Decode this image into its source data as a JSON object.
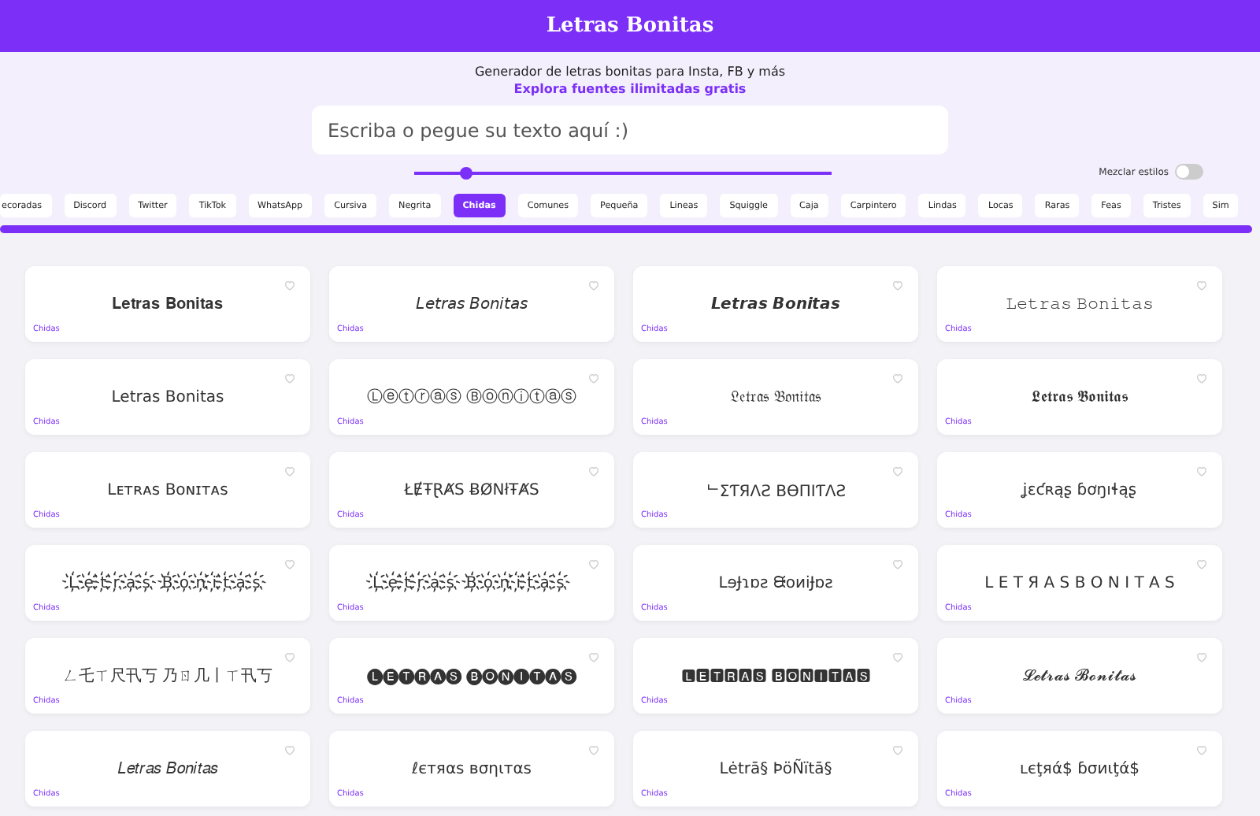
{
  "header": {
    "title": "Letras Bonitas"
  },
  "subtitle": "Generador de letras bonitas para Insta, FB y más",
  "link": "Explora fuentes ilimitadas gratis",
  "input": {
    "placeholder": "Escriba o pegue su texto aquí :)"
  },
  "size_slider": {
    "level": 0.13
  },
  "mix_toggle": {
    "label": "Mezclar estilos",
    "on": false
  },
  "tabs": [
    {
      "label": "ecoradas",
      "selected": false
    },
    {
      "label": "Discord",
      "selected": false
    },
    {
      "label": "Twitter",
      "selected": false
    },
    {
      "label": "TikTok",
      "selected": false
    },
    {
      "label": "WhatsApp",
      "selected": false
    },
    {
      "label": "Cursiva",
      "selected": false
    },
    {
      "label": "Negrita",
      "selected": false
    },
    {
      "label": "Chidas",
      "selected": true
    },
    {
      "label": "Comunes",
      "selected": false
    },
    {
      "label": "Pequeña",
      "selected": false
    },
    {
      "label": "Lineas",
      "selected": false
    },
    {
      "label": "Squiggle",
      "selected": false
    },
    {
      "label": "Caja",
      "selected": false
    },
    {
      "label": "Carpintero",
      "selected": false
    },
    {
      "label": "Lindas",
      "selected": false
    },
    {
      "label": "Locas",
      "selected": false
    },
    {
      "label": "Raras",
      "selected": false
    },
    {
      "label": "Feas",
      "selected": false
    },
    {
      "label": "Tristes",
      "selected": false
    },
    {
      "label": "Sim",
      "selected": false
    }
  ],
  "cards": [
    {
      "text": "𝐋𝐞𝐭𝐫𝐚𝐬 𝐁𝐨𝐧𝐢𝐭𝐚𝐬",
      "category": "Chidas"
    },
    {
      "text": "𝘓𝘦𝘵𝘳𝘢𝘴 𝘉𝘰𝘯𝘪𝘵𝘢𝘴",
      "category": "Chidas"
    },
    {
      "text": "𝙇𝙚𝙩𝙧𝙖𝙨 𝘽𝙤𝙣𝙞𝙩𝙖𝙨",
      "category": "Chidas"
    },
    {
      "text": "𝙻𝚎𝚝𝚛𝚊𝚜 𝙱𝚘𝚗𝚒𝚝𝚊𝚜",
      "category": "Chidas"
    },
    {
      "text": "Letras Bonitas",
      "category": "Chidas"
    },
    {
      "text": "Ⓛⓔⓣⓡⓐⓢ Ⓑⓞⓝⓘⓣⓐⓢ",
      "category": "Chidas"
    },
    {
      "text": "𝔏𝔢𝔱𝔯𝔞𝔰 𝔅𝔬𝔫𝔦𝔱𝔞𝔰",
      "category": "Chidas"
    },
    {
      "text": "𝕷𝖊𝖙𝖗𝖆𝖘 𝕭𝖔𝖓𝖎𝖙𝖆𝖘",
      "category": "Chidas"
    },
    {
      "text": "Lᴇᴛʀᴀs Bᴏɴɪᴛᴀs",
      "category": "Chidas"
    },
    {
      "text": "ŁɆŦⱤȺS ɃØNłŦȺS",
      "category": "Chidas"
    },
    {
      "text": "ᄂΣƬЯΛƧ ΒӨПIƬΛƧ",
      "category": "Chidas"
    },
    {
      "text": "ʝɛƈʀąʂ ɓơŋıɬąʂ",
      "category": "Chidas"
    },
    {
      "text": "L҉e҉t҉r҉a҉s҉ B҉o҉n҉i҉t҉a҉s҉",
      "category": "Chidas"
    },
    {
      "text": "L҉e҉t҉r҉a҉s҉ B҉o҉n҉i҉t҉a҉s҉",
      "category": "Chidas"
    },
    {
      "text": "LɘɈɿɒƨ ᙠoᴎiɈɒƨ",
      "category": "Chidas"
    },
    {
      "text": "L E T Я A S  B O N I T A S",
      "category": "Chidas"
    },
    {
      "text": "ㄥ乇ㄒ尺卂丂 乃ㄖ几丨ㄒ卂丂",
      "category": "Chidas"
    },
    {
      "text": "🅛🅔🅣🅡🅐🅢 🅑🅞🅝🅘🅣🅐🅢",
      "category": "Chidas"
    },
    {
      "text": "🅻🅴🆃🆁🅰🆂 🅱🅾🅽🅸🆃🅰🆂",
      "category": "Chidas"
    },
    {
      "text": "𝓛𝓮𝓽𝓻𝓪𝓼 𝓑𝓸𝓷𝓲𝓽𝓪𝓼",
      "category": "Chidas"
    },
    {
      "text": "𝐿𝑒𝑡𝑟𝑎𝑠 𝐵𝑜𝑛𝑖𝑡𝑎𝑠",
      "category": "Chidas"
    },
    {
      "text": "ℓєтяαѕ вσηιтαѕ",
      "category": "Chidas"
    },
    {
      "text": "Lėtrā§ ÞöÑïtā§",
      "category": "Chidas"
    },
    {
      "text": "ʟєţяά$ ɓσиιţά$",
      "category": "Chidas"
    }
  ]
}
